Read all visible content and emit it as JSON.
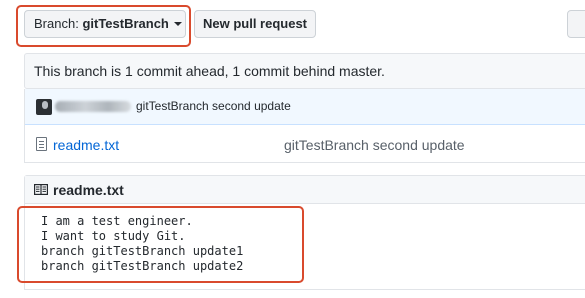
{
  "toolbar": {
    "branch_prefix": "Branch:",
    "branch_name": "gitTestBranch",
    "new_pr_label": "New pull request"
  },
  "status": {
    "message": "This branch is 1 commit ahead, 1 commit behind master."
  },
  "latest_commit": {
    "message": "gitTestBranch second update"
  },
  "files": [
    {
      "name": "readme.txt",
      "last_commit": "gitTestBranch second update"
    }
  ],
  "readme": {
    "title": "readme.txt",
    "lines": [
      "I am a test engineer.",
      "I want to study Git.",
      "branch gitTestBranch update1",
      "branch gitTestBranch update2"
    ]
  },
  "colors": {
    "highlight": "#d94a2d",
    "link": "#0366d6"
  },
  "icons": [
    "caret-down-icon",
    "avatar",
    "file-icon",
    "book-icon"
  ]
}
